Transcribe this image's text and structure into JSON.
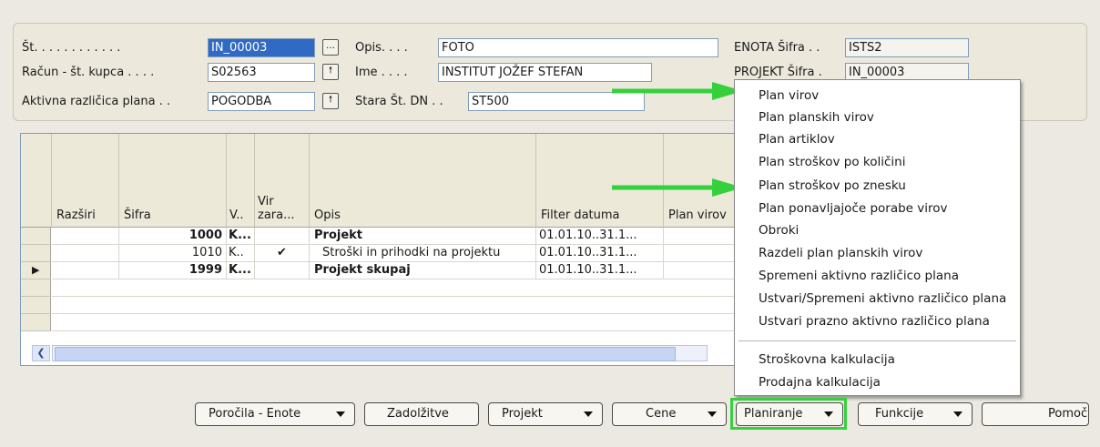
{
  "header": {
    "st_label": "Št. . . . . . . . . . . .",
    "st_value": "IN_00003",
    "racun_label": "Račun - št. kupca . . . .",
    "racun_value": "S02563",
    "aktivna_label": "Aktivna različica plana . .",
    "aktivna_value": "POGODBA",
    "opis_label": "Opis. . . .",
    "opis_value": "FOTO",
    "ime_label": "Ime . . . .",
    "ime_value": "INSTITUT JOŽEF STEFAN",
    "stara_label": "Stara Št. DN . .",
    "stara_value": "ST500",
    "enota_label": "ENOTA Šifra . .",
    "enota_value": "ISTS2",
    "projekt_label": "PROJEKT Šifra .",
    "projekt_value": "IN_00003"
  },
  "grid": {
    "columns": [
      "Razširi",
      "Šifra",
      "V..",
      "Vir zara...",
      "Opis",
      "Filter datuma",
      "Plan virov"
    ],
    "rows": [
      {
        "sifra": "1000",
        "v": "K...",
        "vir": "",
        "opis": "Projekt",
        "filter": "01.01.10..31.1...",
        "bold": true,
        "indicator": ""
      },
      {
        "sifra": "1010",
        "v": "K..",
        "vir": "✔",
        "opis": "Stroški in prihodki na projektu",
        "filter": "01.01.10..31.1...",
        "bold": false,
        "indicator": ""
      },
      {
        "sifra": "1999",
        "v": "K...",
        "vir": "",
        "opis": "Projekt skupaj",
        "filter": "01.01.10..31.1...",
        "bold": true,
        "indicator": "▶"
      }
    ]
  },
  "menu": {
    "items": [
      "Plan virov",
      "Plan planskih virov",
      "Plan artiklov",
      "Plan stroškov po količini",
      "Plan stroškov po znesku",
      "Plan ponavljajoče porabe virov",
      "Obroki",
      "Razdeli plan planskih virov",
      "Spremeni aktivno različico plana",
      "Ustvari/Spremeni aktivno različico plana",
      "Ustvari prazno aktivno različico plana",
      "Stroškovna kalkulacija",
      "Prodajna kalkulacija"
    ]
  },
  "buttons": {
    "porocila": "Poročila - Enote",
    "zadolzitve": "Zadolžitve",
    "projekt": "Projekt",
    "cene": "Cene",
    "planiranje": "Planiranje",
    "funkcije": "Funkcije",
    "pomoc": "Pomoč"
  },
  "colors": {
    "arrow": "#35d13d",
    "highlight": "#35d13d",
    "selection": "#316ac5"
  }
}
